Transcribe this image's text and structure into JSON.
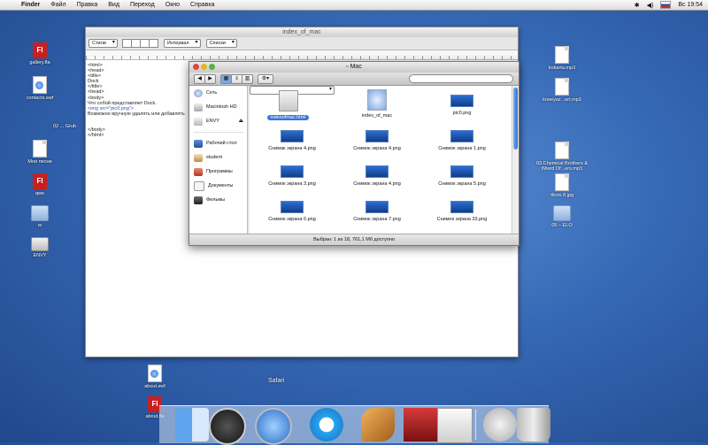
{
  "menubar": {
    "app": "Finder",
    "items": [
      "Файл",
      "Правка",
      "Вид",
      "Переход",
      "Окно",
      "Справка"
    ],
    "clock": "Вс 19:54"
  },
  "desktop_icons": [
    {
      "label": "gallery.fla",
      "icon": "fla-icon"
    },
    {
      "label": "contacts.swf",
      "icon": "swf-icon"
    },
    {
      "label": "Мои песни",
      "icon": "document-icon"
    },
    {
      "label": "qwe",
      "icon": "fla-icon"
    },
    {
      "label": "м",
      "icon": "folder-icon"
    },
    {
      "label": "ENVY",
      "icon": "disk-icon"
    },
    {
      "label": "kokarta.mp3",
      "icon": "document-icon"
    },
    {
      "label": "kneeyaz ..ert.mp3",
      "icon": "audio-icon"
    },
    {
      "label": "03.Chemical Brothers & Wierd Of ..ers.mp3",
      "icon": "document-icon"
    },
    {
      "label": "Фото 8.jpg",
      "icon": "document-icon"
    },
    {
      "label": "05 – ELO",
      "icon": "folder-icon"
    },
    {
      "label": "about.swf",
      "icon": "swf-icon"
    },
    {
      "label": "about.fla",
      "icon": "fla-icon"
    },
    {
      "label": "02 ... Grub",
      "icon": "document-icon"
    }
  ],
  "textedit": {
    "title": "index_of_mac",
    "styles_label": "Стили",
    "spacing_label": "Интервал",
    "lists_label": "Списки",
    "lines": [
      "<html>",
      "<head>",
      "<title>",
      "Dock",
      "</title>",
      "<head>",
      "<body>",
      "Что собой представляет Dock.",
      "<img src=\"pic0.png\">",
      "Возможно вручную удалять или добавлять",
      "",
      "",
      "</body>",
      "</html>"
    ]
  },
  "finder": {
    "title": "Mac",
    "search_placeholder": "",
    "sidebar": [
      {
        "label": "Сеть",
        "icon": "network-icon"
      },
      {
        "label": "Macintosh HD",
        "icon": "hard-disk-icon"
      },
      {
        "label": "ENVY",
        "icon": "disk-icon"
      },
      {
        "label": "Рабочий стол",
        "icon": "desktop-icon"
      },
      {
        "label": "student",
        "icon": "home-icon"
      },
      {
        "label": "Программы",
        "icon": "applications-icon"
      },
      {
        "label": "Документы",
        "icon": "documents-icon"
      },
      {
        "label": "Фильмы",
        "icon": "movies-icon"
      }
    ],
    "files": [
      {
        "label": "indexofmac.html",
        "icon": "html-file-icon",
        "selected": true
      },
      {
        "label": "index_of_mac",
        "icon": "document-icon"
      },
      {
        "label": "pic0.png",
        "icon": "png-thumbnail"
      },
      {
        "label": "Снимак экрана 4.png",
        "icon": "png-thumbnail"
      },
      {
        "label": "Снимок экрана 4.png",
        "icon": "png-thumbnail"
      },
      {
        "label": "Снимок экрана 1.png",
        "icon": "png-thumbnail"
      },
      {
        "label": "Снимок экрана 3.png",
        "icon": "png-thumbnail"
      },
      {
        "label": "Снимок экрана 4.png",
        "icon": "png-thumbnail"
      },
      {
        "label": "Снимок экрана 5.png",
        "icon": "png-thumbnail"
      },
      {
        "label": "Снимок экрана 6.png",
        "icon": "png-thumbnail"
      },
      {
        "label": "Снимок экрана 7.png",
        "icon": "png-thumbnail"
      },
      {
        "label": "Снимок экрана 33.png",
        "icon": "png-thumbnail"
      }
    ],
    "status": "Выбран: 1 из 18, 761,1 Мб доступно"
  },
  "dock": {
    "hover_label": "Safari",
    "items": [
      "finder-icon",
      "dashboard-icon",
      "safari-icon",
      "quicktime-icon",
      "garageband-icon",
      "imovie-icon",
      "textedit-icon",
      "mail-icon",
      "trash-icon"
    ]
  }
}
